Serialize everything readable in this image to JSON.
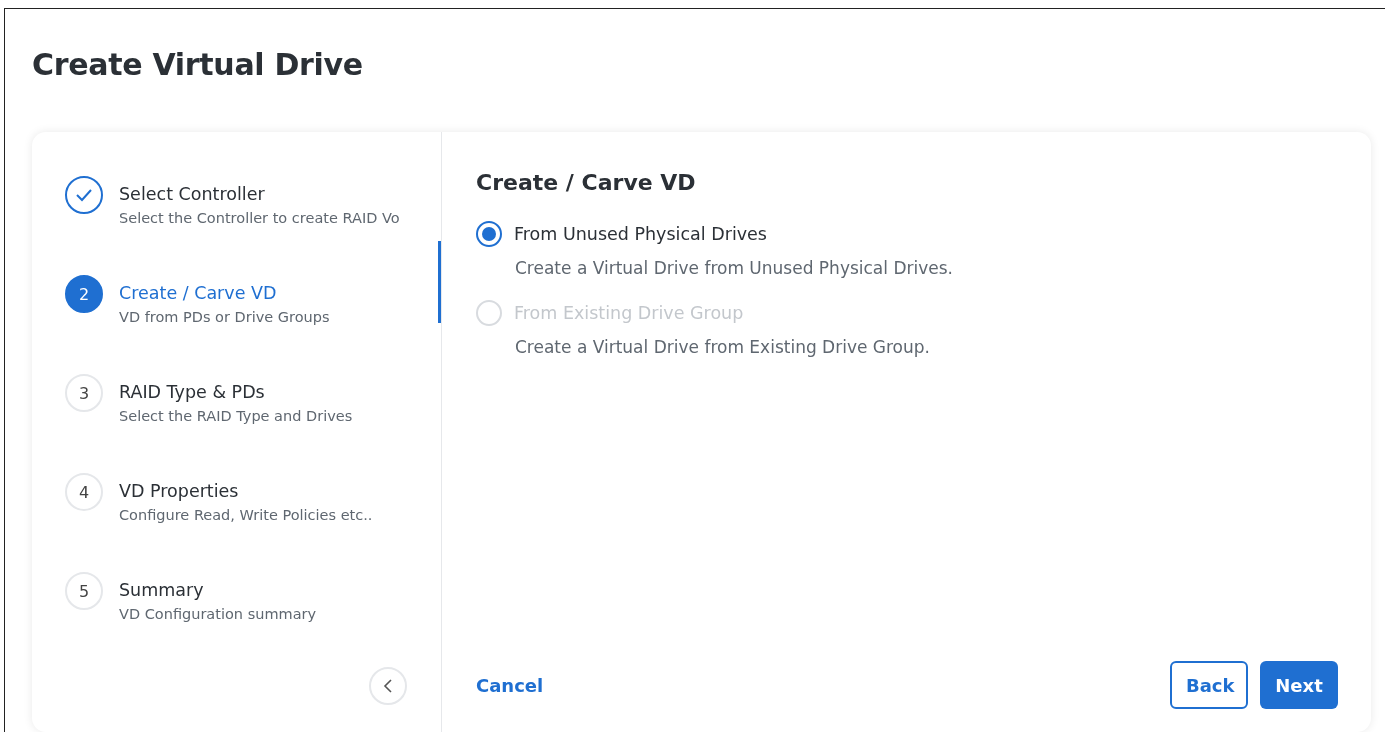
{
  "page_title": "Create Virtual Drive",
  "steps": [
    {
      "title": "Select Controller",
      "subtitle": "Select the Controller to create RAID Vo",
      "completed": true,
      "selected": false
    },
    {
      "number": "2",
      "title": "Create / Carve VD",
      "subtitle": "VD from PDs or Drive Groups",
      "completed": false,
      "selected": true
    },
    {
      "number": "3",
      "title": "RAID Type & PDs",
      "subtitle": "Select the RAID Type and Drives",
      "completed": false,
      "selected": false
    },
    {
      "number": "4",
      "title": "VD Properties",
      "subtitle": "Configure Read, Write Policies etc..",
      "completed": false,
      "selected": false
    },
    {
      "number": "5",
      "title": "Summary",
      "subtitle": "VD Configuration summary",
      "completed": false,
      "selected": false
    }
  ],
  "content": {
    "heading": "Create / Carve VD",
    "options": [
      {
        "label": "From Unused Physical Drives",
        "description": "Create a Virtual Drive from Unused Physical Drives.",
        "selected": true,
        "disabled": false
      },
      {
        "label": "From Existing Drive Group",
        "description": "Create a Virtual Drive from Existing Drive Group.",
        "selected": false,
        "disabled": true
      }
    ]
  },
  "footer": {
    "cancel": "Cancel",
    "back": "Back",
    "next": "Next"
  }
}
